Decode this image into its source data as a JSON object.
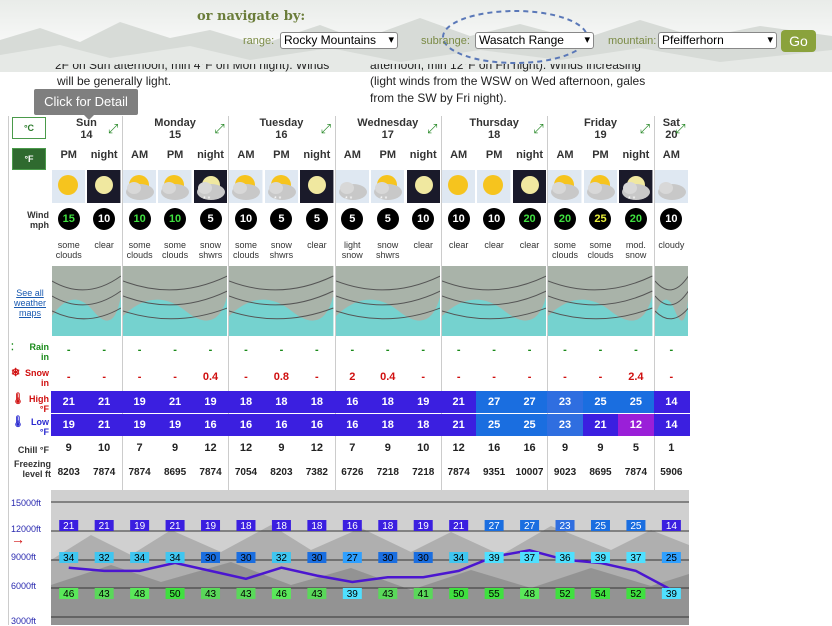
{
  "nav": {
    "heading": "or navigate by:",
    "range_label": "range:",
    "range_value": "Rocky Mountains",
    "subrange_label": "subrange:",
    "subrange_value": "Wasatch Range",
    "mountain_label": "mountain:",
    "mountain_value": "Pfeifferhorn",
    "go_label": "Go"
  },
  "tooltip": "Click for Detail",
  "overlay": {
    "left_line1": "2F on Sun afternoon, min 4°F on Mon night). Winds",
    "left_line2": "will be generally light.",
    "right_line1": "afternoon, min 12°F on Fri night). Winds increasing",
    "right_line2": "(light winds from the WSW on Wed afternoon, gales",
    "right_line3": "from the SW by Fri night)."
  },
  "units": {
    "c": "°C",
    "f": "°F"
  },
  "days": [
    {
      "name": "Sun",
      "date": "14",
      "periods": 2
    },
    {
      "name": "Monday",
      "date": "15",
      "periods": 3
    },
    {
      "name": "Tuesday",
      "date": "16",
      "periods": 3
    },
    {
      "name": "Wednesday",
      "date": "17",
      "periods": 3
    },
    {
      "name": "Thursday",
      "date": "18",
      "periods": 3
    },
    {
      "name": "Friday",
      "date": "19",
      "periods": 3
    },
    {
      "name": "Sat",
      "date": "20",
      "periods": 1
    }
  ],
  "periods": [
    "PM",
    "night",
    "AM",
    "PM",
    "night",
    "AM",
    "PM",
    "night",
    "AM",
    "PM",
    "night",
    "AM",
    "PM",
    "night",
    "AM",
    "PM",
    "night",
    "AM"
  ],
  "icons": [
    "partly-sunny-icon",
    "moon-icon",
    "cloudy-sun-icon",
    "cloudy-sun-icon",
    "cloudy-moon-snow-icon",
    "cloudy-sun-icon",
    "cloudy-sun-snow-icon",
    "moon-icon",
    "cloud-snow-icon",
    "cloudy-sun-snow-icon",
    "moon-icon",
    "sun-icon",
    "sun-icon",
    "moon-icon",
    "cloudy-sun-icon",
    "cloudy-sun-icon",
    "cloud-snow-night-icon",
    "cloud-icon"
  ],
  "side_labels": {
    "wind": "Wind",
    "wind_unit": "mph",
    "maps": "See all weather maps",
    "rain": "Rain",
    "rain_unit": "in",
    "snow": "Snow",
    "snow_unit": "in",
    "high": "High",
    "high_unit": "°F",
    "low": "Low",
    "low_unit": "°F",
    "chill": "Chill °F",
    "freezing": "Freezing level ft"
  },
  "wind": [
    "15",
    "10",
    "10",
    "10",
    "5",
    "10",
    "5",
    "5",
    "5",
    "5",
    "10",
    "10",
    "10",
    "20",
    "20",
    "25",
    "20",
    "10"
  ],
  "wind_colors": [
    "g",
    "w",
    "g",
    "g",
    "w",
    "w",
    "w",
    "w",
    "w",
    "w",
    "w",
    "w",
    "w",
    "g",
    "g",
    "y",
    "g",
    "w"
  ],
  "summary": [
    [
      "some",
      "clouds"
    ],
    [
      "",
      "clear"
    ],
    [
      "some",
      "clouds"
    ],
    [
      "some",
      "clouds"
    ],
    [
      "snow",
      "shwrs"
    ],
    [
      "some",
      "clouds"
    ],
    [
      "snow",
      "shwrs"
    ],
    [
      "",
      "clear"
    ],
    [
      "light",
      "snow"
    ],
    [
      "snow",
      "shwrs"
    ],
    [
      "",
      "clear"
    ],
    [
      "",
      "clear"
    ],
    [
      "",
      "clear"
    ],
    [
      "",
      "clear"
    ],
    [
      "some",
      "clouds"
    ],
    [
      "some",
      "clouds"
    ],
    [
      "mod.",
      "snow"
    ],
    [
      "",
      "cloudy"
    ]
  ],
  "rain": [
    "-",
    "-",
    "-",
    "-",
    "-",
    "-",
    "-",
    "-",
    "-",
    "-",
    "-",
    "-",
    "-",
    "-",
    "-",
    "-",
    "-",
    "-"
  ],
  "snow": [
    "-",
    "-",
    "-",
    "-",
    "0.4",
    "-",
    "0.8",
    "-",
    "2",
    "0.4",
    "-",
    "-",
    "-",
    "-",
    "-",
    "-",
    "2.4",
    "-"
  ],
  "high": [
    "21",
    "21",
    "19",
    "21",
    "19",
    "18",
    "18",
    "18",
    "16",
    "18",
    "19",
    "21",
    "27",
    "27",
    "23",
    "25",
    "25",
    "14"
  ],
  "low": [
    "19",
    "21",
    "19",
    "19",
    "16",
    "16",
    "16",
    "16",
    "16",
    "18",
    "18",
    "21",
    "25",
    "25",
    "23",
    "21",
    "12",
    "14"
  ],
  "chill": [
    "9",
    "10",
    "7",
    "9",
    "12",
    "12",
    "9",
    "12",
    "7",
    "9",
    "10",
    "12",
    "16",
    "16",
    "9",
    "9",
    "5",
    "1"
  ],
  "freezing": [
    "8203",
    "7874",
    "7874",
    "8695",
    "7874",
    "7054",
    "8203",
    "7382",
    "6726",
    "7218",
    "7218",
    "7874",
    "9351",
    "10007",
    "9023",
    "8695",
    "7874",
    "5906"
  ],
  "chart": {
    "y_labels": [
      "15000ft",
      "12000ft",
      "9000ft",
      "6000ft",
      "3000ft"
    ],
    "top_row": [
      "21",
      "21",
      "19",
      "21",
      "19",
      "18",
      "18",
      "18",
      "16",
      "18",
      "19",
      "21",
      "27",
      "27",
      "23",
      "25",
      "25",
      "14"
    ],
    "mid_row": [
      "34",
      "32",
      "34",
      "34",
      "30",
      "30",
      "32",
      "30",
      "27",
      "30",
      "30",
      "34",
      "39",
      "37",
      "36",
      "39",
      "37",
      "25"
    ],
    "bot_row": [
      "46",
      "43",
      "48",
      "50",
      "43",
      "43",
      "46",
      "43",
      "39",
      "43",
      "41",
      "50",
      "55",
      "48",
      "52",
      "54",
      "52",
      "39"
    ]
  },
  "colors": {
    "accent": "#8aa23c",
    "temp_dark": "#3b1fe0",
    "temp_mid": "#1a6ee0",
    "temp_light": "#2fa0ff",
    "freeze_line": "#4b16d0",
    "green": "#3fe03f"
  }
}
